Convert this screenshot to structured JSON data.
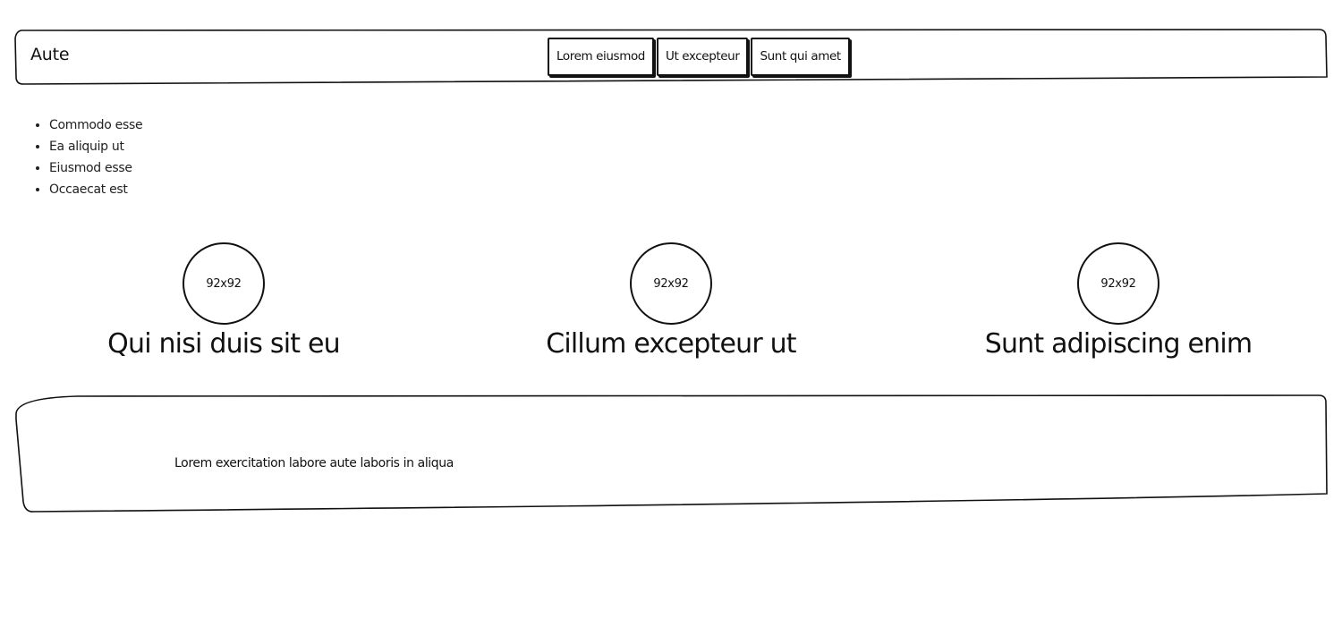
{
  "header": {
    "brand": "Aute",
    "nav": [
      {
        "label": "Lorem eiusmod"
      },
      {
        "label": "Ut excepteur"
      },
      {
        "label": "Sunt qui amet"
      }
    ]
  },
  "list": {
    "items": [
      "Commodo esse",
      "Ea aliquip ut",
      "Eiusmod esse",
      "Occaecat est"
    ]
  },
  "features": [
    {
      "image_label": "92x92",
      "title": "Qui nisi duis sit eu"
    },
    {
      "image_label": "92x92",
      "title": "Cillum excepteur ut"
    },
    {
      "image_label": "92x92",
      "title": "Sunt adipiscing enim"
    }
  ],
  "footer": {
    "text": "Lorem exercitation labore aute laboris in aliqua"
  }
}
